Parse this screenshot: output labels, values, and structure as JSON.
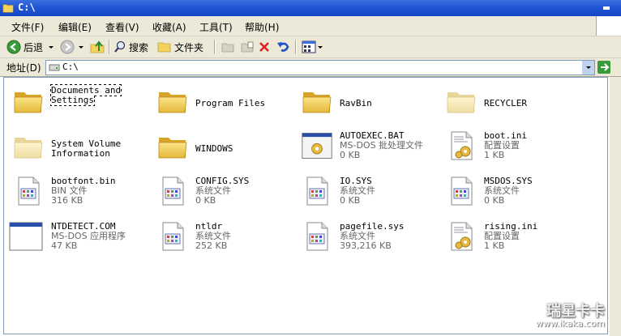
{
  "window": {
    "title": "C:\\"
  },
  "menu": [
    {
      "id": "file",
      "label": "文件(F)"
    },
    {
      "id": "edit",
      "label": "编辑(E)"
    },
    {
      "id": "view",
      "label": "查看(V)"
    },
    {
      "id": "favorites",
      "label": "收藏(A)"
    },
    {
      "id": "tools",
      "label": "工具(T)"
    },
    {
      "id": "help",
      "label": "帮助(H)"
    }
  ],
  "toolbar": {
    "back_label": "后退",
    "search_label": "搜索",
    "folders_label": "文件夹"
  },
  "address": {
    "label": "地址(D)",
    "value": "C:\\"
  },
  "items": [
    {
      "name": "Documents and Settings",
      "sub1": "",
      "sub2": "",
      "icon": "folder-icon"
    },
    {
      "name": "Program Files",
      "sub1": "",
      "sub2": "",
      "icon": "folder-icon"
    },
    {
      "name": "RavBin",
      "sub1": "",
      "sub2": "",
      "icon": "folder-icon"
    },
    {
      "name": "RECYCLER",
      "sub1": "",
      "sub2": "",
      "icon": "folder-hidden-icon"
    },
    {
      "name": "System Volume Information",
      "sub1": "",
      "sub2": "",
      "icon": "folder-hidden-icon"
    },
    {
      "name": "WINDOWS",
      "sub1": "",
      "sub2": "",
      "icon": "folder-icon"
    },
    {
      "name": "AUTOEXEC.BAT",
      "sub1": "MS-DOS 批处理文件",
      "sub2": "0 KB",
      "icon": "batch-file-icon"
    },
    {
      "name": "boot.ini",
      "sub1": "配置设置",
      "sub2": "1 KB",
      "icon": "config-file-icon"
    },
    {
      "name": "bootfont.bin",
      "sub1": "BIN 文件",
      "sub2": "316 KB",
      "icon": "system-file-icon"
    },
    {
      "name": "CONFIG.SYS",
      "sub1": "系统文件",
      "sub2": "0 KB",
      "icon": "system-file-icon"
    },
    {
      "name": "IO.SYS",
      "sub1": "系统文件",
      "sub2": "0 KB",
      "icon": "system-file-icon"
    },
    {
      "name": "MSDOS.SYS",
      "sub1": "系统文件",
      "sub2": "0 KB",
      "icon": "system-file-icon"
    },
    {
      "name": "NTDETECT.COM",
      "sub1": "MS-DOS 应用程序",
      "sub2": "47 KB",
      "icon": "dos-app-icon"
    },
    {
      "name": "ntldr",
      "sub1": "系统文件",
      "sub2": "252 KB",
      "icon": "system-file-icon"
    },
    {
      "name": "pagefile.sys",
      "sub1": "系统文件",
      "sub2": "393,216 KB",
      "icon": "system-file-icon"
    },
    {
      "name": "rising.ini",
      "sub1": "配置设置",
      "sub2": "1 KB",
      "icon": "config-file-icon"
    }
  ],
  "watermark": {
    "brand": "瑞星卡卡",
    "url": "www.ikaka.com"
  }
}
